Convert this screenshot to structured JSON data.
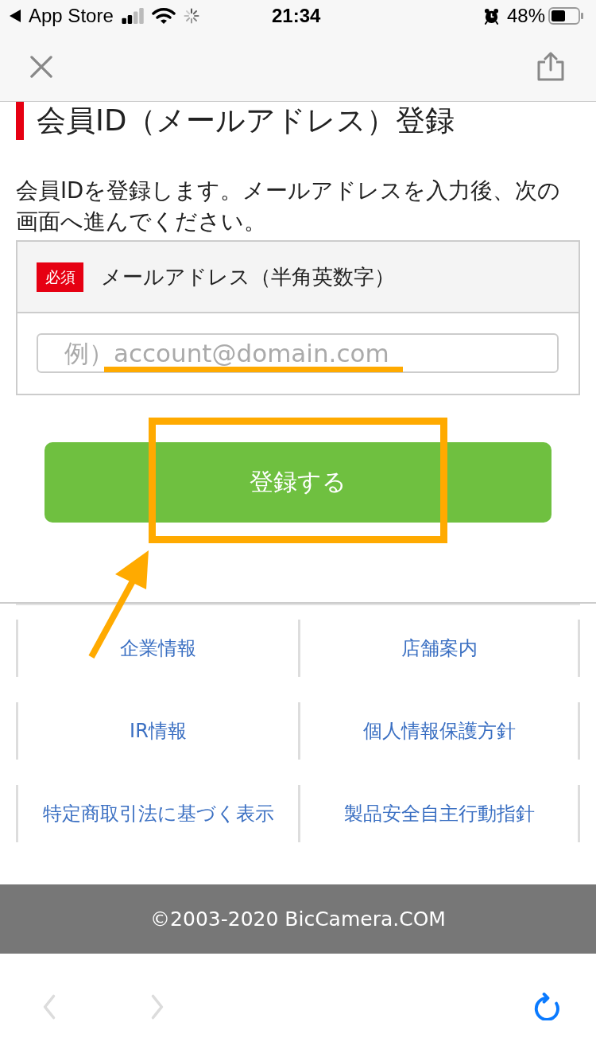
{
  "status_bar": {
    "back_label": "App Store",
    "time": "21:34",
    "battery": "48%"
  },
  "page": {
    "title": "会員ID（メールアドレス）登録",
    "intro": "会員IDを登録します。メールアドレスを入力後、次の画面へ進んでください。"
  },
  "form": {
    "fields": [
      {
        "badge": "必須",
        "label": "メールアドレス（半角英数字）",
        "placeholder": "例）account@domain.com"
      }
    ],
    "submit": "登録する"
  },
  "footer_links": [
    "企業情報",
    "店舗案内",
    "IR情報",
    "個人情報保護方針",
    "特定商取引法に基づく表示",
    "製品安全自主行動指針"
  ],
  "copyright": "©2003-2020 BicCamera.COM",
  "toolbar": {
    "buttons": [
      {
        "kind": "back",
        "disabled": true
      },
      {
        "kind": "forward",
        "disabled": true
      },
      {
        "kind": "reload",
        "disabled": false
      }
    ]
  }
}
